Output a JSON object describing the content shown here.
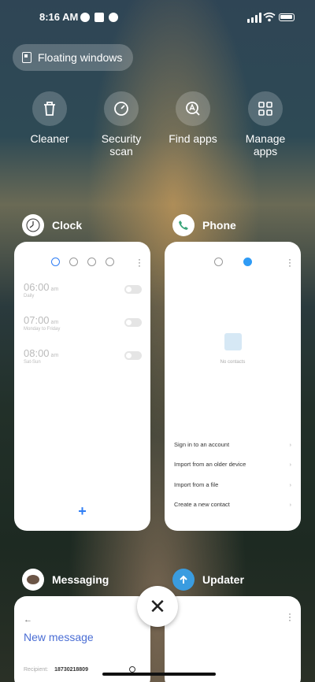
{
  "status": {
    "time": "8:16 AM"
  },
  "floating": {
    "label": "Floating windows"
  },
  "tools": [
    {
      "label": "Cleaner",
      "icon": "trash-icon"
    },
    {
      "label": "Security scan",
      "icon": "security-icon"
    },
    {
      "label": "Find apps",
      "icon": "find-apps-icon"
    },
    {
      "label": "Manage apps",
      "icon": "grid-icon"
    }
  ],
  "apps": {
    "clock": {
      "name": "Clock",
      "alarms": [
        {
          "time": "06:00",
          "ampm": "am",
          "sub": "Daily"
        },
        {
          "time": "07:00",
          "ampm": "am",
          "sub": "Monday to Friday"
        },
        {
          "time": "08:00",
          "ampm": "am",
          "sub": "Sat-Sun"
        }
      ],
      "add": "+"
    },
    "phone": {
      "name": "Phone",
      "empty": "No contacts",
      "options": [
        "Sign in to an account",
        "Import from an older device",
        "Import from a file",
        "Create a new contact"
      ],
      "chev": "›"
    },
    "messaging": {
      "name": "Messaging",
      "back": "←",
      "title": "New message",
      "recipient_label": "Recipient:",
      "recipient_value": "18730218809"
    },
    "updater": {
      "name": "Updater"
    }
  },
  "close": {
    "symbol": "✕"
  }
}
